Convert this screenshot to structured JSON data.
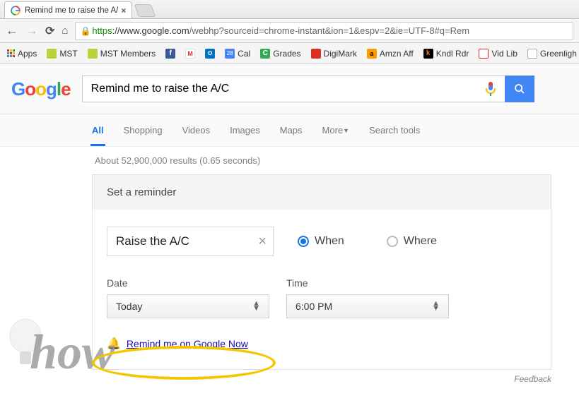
{
  "browser": {
    "tab_title": "Remind me to raise the A/",
    "url_https": "https",
    "url_host": "://www.google.com",
    "url_path": "/webhp?sourceid=chrome-instant&ion=1&espv=2&ie=UTF-8#q=Rem"
  },
  "bookmarks": {
    "apps": "Apps",
    "items": [
      {
        "label": "MST",
        "color": "#b8d43c"
      },
      {
        "label": "MST Members",
        "color": "#b8d43c"
      },
      {
        "label": "",
        "icon": "fb",
        "color": "#3b5998"
      },
      {
        "label": "",
        "icon": "gm",
        "color": "#d93025"
      },
      {
        "label": "",
        "icon": "ol",
        "color": "#0072c6"
      },
      {
        "label": "Cal",
        "color": "#4285f4"
      },
      {
        "label": "Grades",
        "color": "#34a853"
      },
      {
        "label": "DigiMark",
        "color": "#d93025"
      },
      {
        "label": "Amzn Aff",
        "color": "#ff9900"
      },
      {
        "label": "Kndl Rdr",
        "color": "#e47911"
      },
      {
        "label": "Vid Lib",
        "color": "#d93025"
      },
      {
        "label": "Greenligh",
        "color": "#ccc",
        "doc": true
      }
    ]
  },
  "search": {
    "query": "Remind me to raise the A/C"
  },
  "tabs": {
    "items": [
      "All",
      "Shopping",
      "Videos",
      "Images",
      "Maps",
      "More",
      "Search tools"
    ],
    "active": "All"
  },
  "stats": "About 52,900,000 results (0.65 seconds)",
  "card": {
    "title": "Set a reminder",
    "reminder_text": "Raise the A/C",
    "when_label": "When",
    "where_label": "Where",
    "date_label": "Date",
    "date_value": "Today",
    "time_label": "Time",
    "time_value": "6:00 PM",
    "link_text": "Remind me on Google Now"
  },
  "feedback": "Feedback",
  "watermark": "how"
}
